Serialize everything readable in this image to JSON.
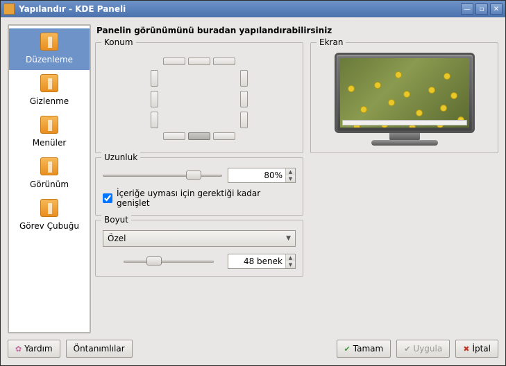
{
  "window": {
    "title": "Yapılandır - KDE Paneli"
  },
  "sidebar": {
    "items": [
      {
        "label": "Düzenleme"
      },
      {
        "label": "Gizlenme"
      },
      {
        "label": "Menüler"
      },
      {
        "label": "Görünüm"
      },
      {
        "label": "Görev Çubuğu"
      }
    ],
    "selected_index": 0
  },
  "main": {
    "heading": "Panelin görünümünü buradan yapılandırabilirsiniz",
    "konum": {
      "legend": "Konum"
    },
    "ekran": {
      "legend": "Ekran"
    },
    "uzunluk": {
      "legend": "Uzunluk",
      "value_display": "80%",
      "value_percent": 80,
      "checkbox_label": "İçeriğe uyması için gerektiği kadar genişlet",
      "checkbox_checked": true
    },
    "boyut": {
      "legend": "Boyut",
      "combo_value": "Özel",
      "spin_display": "48 benek"
    }
  },
  "buttons": {
    "help": "Yardım",
    "defaults": "Öntanımlılar",
    "ok": "Tamam",
    "apply": "Uygula",
    "cancel": "İptal"
  }
}
